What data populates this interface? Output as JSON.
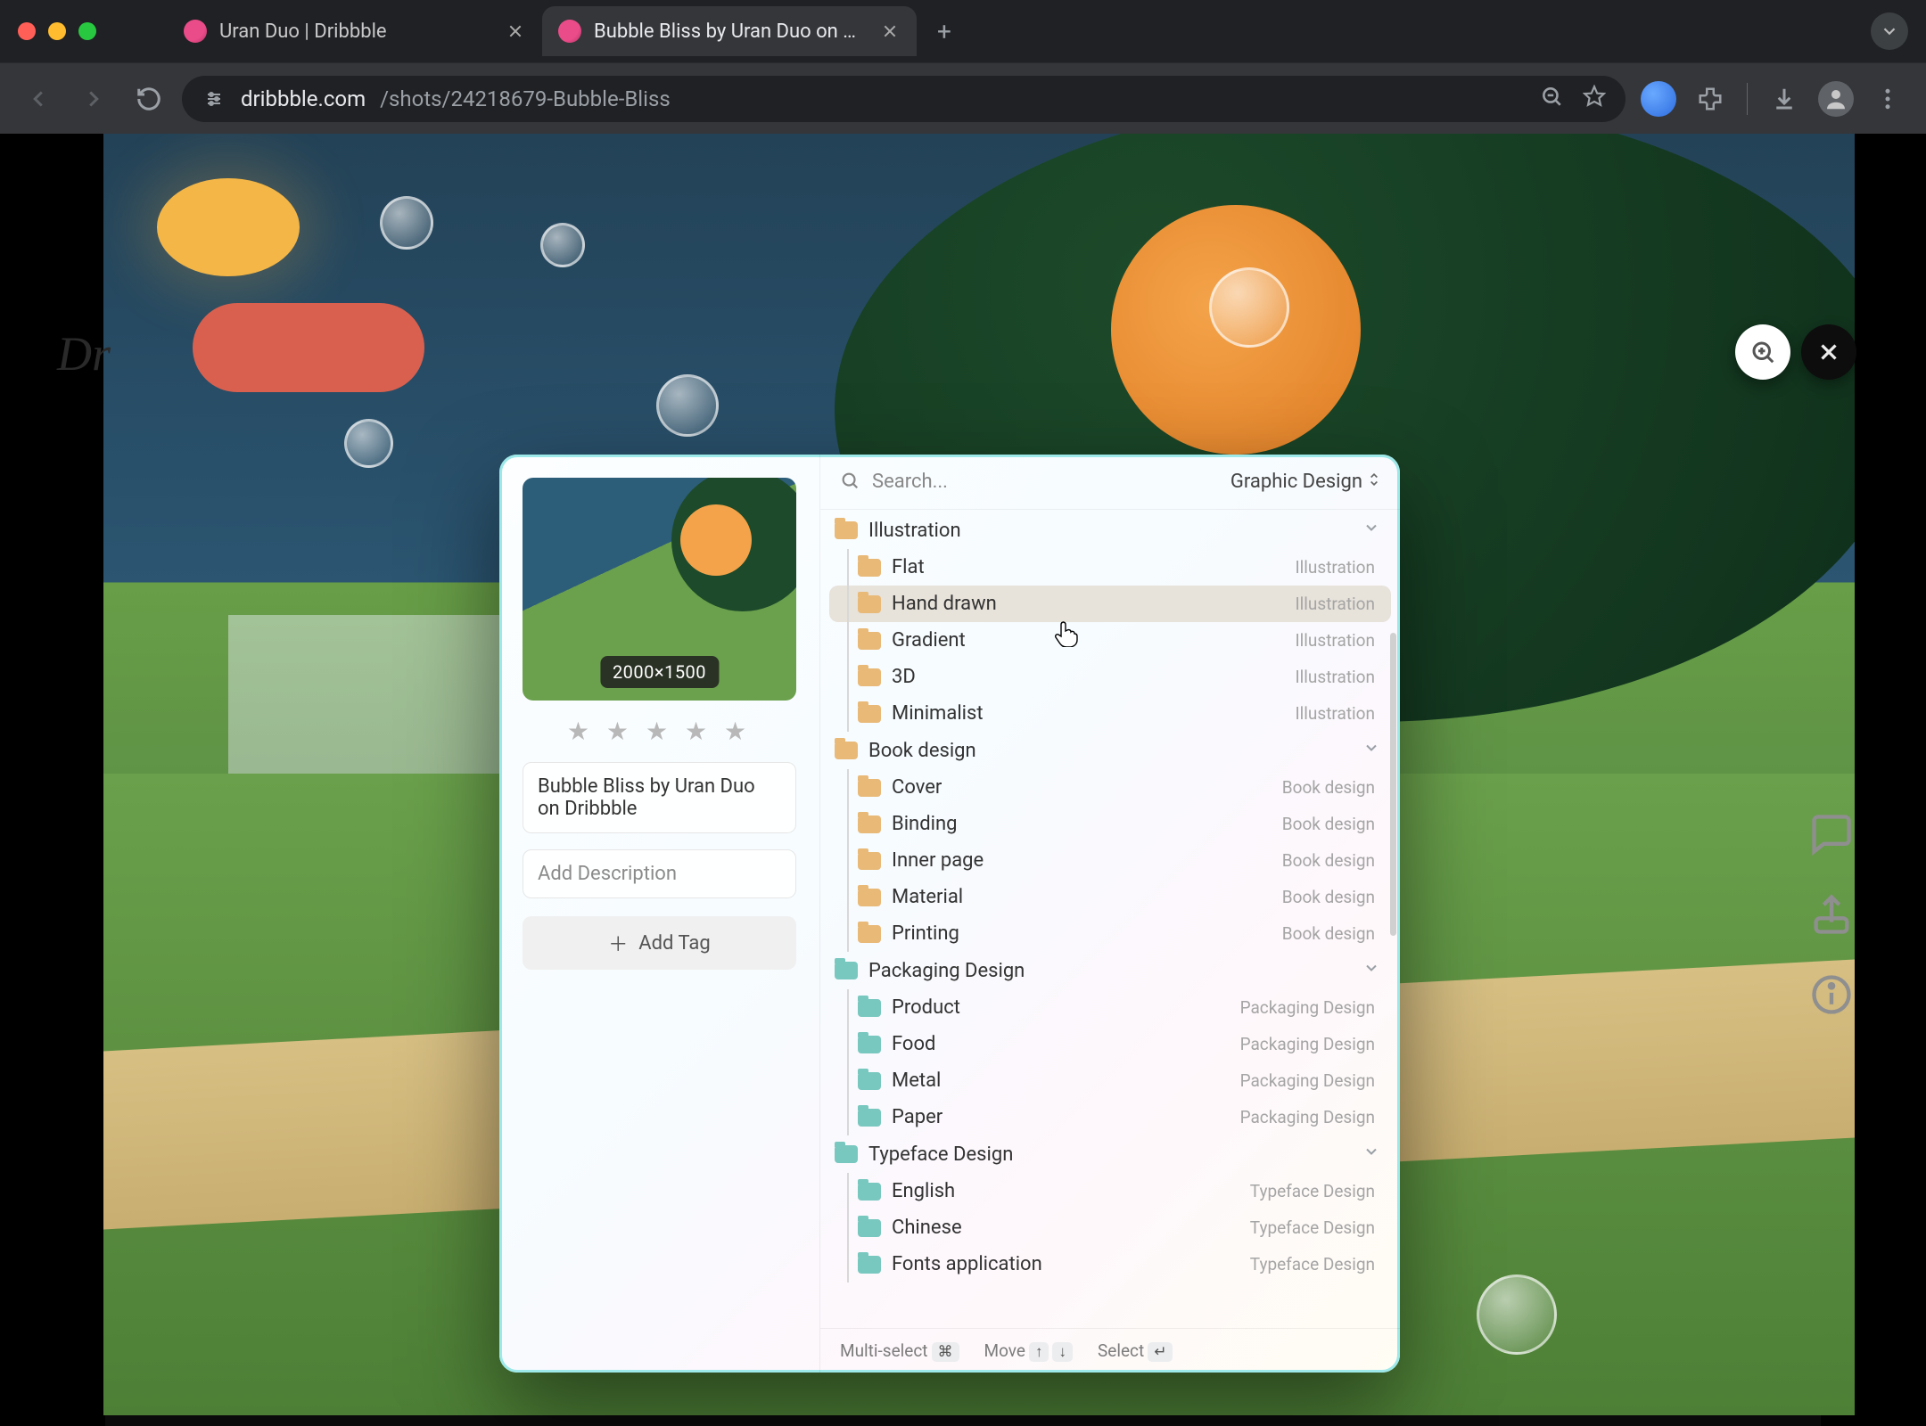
{
  "browser": {
    "tabs": [
      {
        "title": "Uran Duo | Dribbble",
        "active": false
      },
      {
        "title": "Bubble Bliss by Uran Duo on Dribbble",
        "active": true
      }
    ],
    "url_host": "dribbble.com",
    "url_path": "/shots/24218679-Bubble-Bliss"
  },
  "page": {
    "logo_text": "Dr"
  },
  "modal": {
    "thumb_dimensions": "2000×1500",
    "title_value": "Bubble Bliss by Uran Duo on Dribbble",
    "description_placeholder": "Add Description",
    "add_tag_label": "Add Tag",
    "search_placeholder": "Search...",
    "category_label": "Graphic Design",
    "hints": {
      "multiselect": "Multi-select",
      "multiselect_key": "⌘",
      "move": "Move",
      "move_up": "↑",
      "move_down": "↓",
      "select": "Select",
      "select_key": "↵"
    },
    "groups": [
      {
        "name": "Illustration",
        "color": "orange",
        "items": [
          {
            "label": "Flat",
            "trail": "Illustration",
            "highlight": false
          },
          {
            "label": "Hand drawn",
            "trail": "Illustration",
            "highlight": true
          },
          {
            "label": "Gradient",
            "trail": "Illustration",
            "highlight": false
          },
          {
            "label": "3D",
            "trail": "Illustration",
            "highlight": false
          },
          {
            "label": "Minimalist",
            "trail": "Illustration",
            "highlight": false
          }
        ]
      },
      {
        "name": "Book design",
        "color": "orange",
        "items": [
          {
            "label": "Cover",
            "trail": "Book design"
          },
          {
            "label": "Binding",
            "trail": "Book design"
          },
          {
            "label": "Inner page",
            "trail": "Book design"
          },
          {
            "label": "Material",
            "trail": "Book design"
          },
          {
            "label": "Printing",
            "trail": "Book design"
          }
        ]
      },
      {
        "name": "Packaging Design",
        "color": "teal",
        "items": [
          {
            "label": "Product",
            "trail": "Packaging Design"
          },
          {
            "label": "Food",
            "trail": "Packaging Design"
          },
          {
            "label": "Metal",
            "trail": "Packaging Design"
          },
          {
            "label": "Paper",
            "trail": "Packaging Design"
          }
        ]
      },
      {
        "name": "Typeface Design",
        "color": "teal",
        "items": [
          {
            "label": "English",
            "trail": "Typeface Design"
          },
          {
            "label": "Chinese",
            "trail": "Typeface Design"
          },
          {
            "label": "Fonts application",
            "trail": "Typeface Design"
          }
        ]
      }
    ]
  }
}
